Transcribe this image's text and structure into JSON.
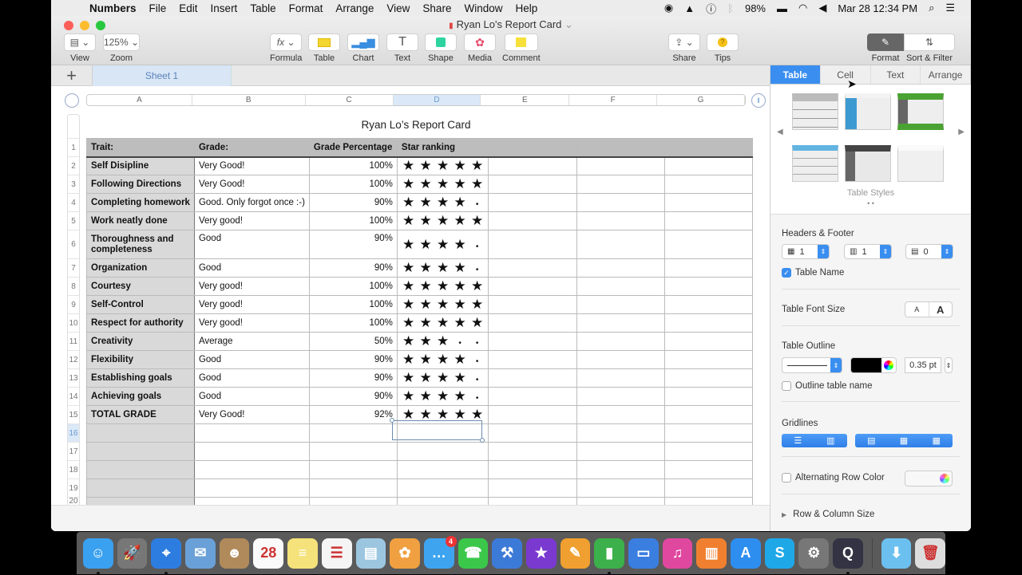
{
  "menubar": {
    "app_name": "Numbers",
    "items": [
      "File",
      "Edit",
      "Insert",
      "Table",
      "Format",
      "Arrange",
      "View",
      "Share",
      "Window",
      "Help"
    ],
    "status": {
      "battery": "98%",
      "datetime": "Mar 28  12:34 PM"
    }
  },
  "window": {
    "title": "Ryan Lo's Report Card",
    "toolbar": {
      "view": "View",
      "zoom_label": "Zoom",
      "zoom_value": "125%",
      "formula": "Formula",
      "table": "Table",
      "chart": "Chart",
      "text": "Text",
      "shape": "Shape",
      "media": "Media",
      "comment": "Comment",
      "share": "Share",
      "tips": "Tips",
      "format": "Format",
      "sort_filter": "Sort & Filter"
    },
    "sheet_tab": "Sheet 1"
  },
  "spreadsheet": {
    "columns": [
      "A",
      "B",
      "C",
      "D",
      "E",
      "F",
      "G"
    ],
    "selected_column": "D",
    "selected_row": 16,
    "row_numbers": [
      "1",
      "2",
      "3",
      "4",
      "5",
      "6",
      "7",
      "8",
      "9",
      "10",
      "11",
      "12",
      "13",
      "14",
      "15",
      "16",
      "17",
      "18",
      "19",
      "20"
    ],
    "table_name": "Ryan Lo’s Report Card",
    "headers": [
      "Trait:",
      "Grade:",
      "Grade Percentage",
      "Star ranking"
    ],
    "rows": [
      {
        "trait": "Self Disipline",
        "grade": "Very Good!",
        "pct": "100%",
        "stars": 5
      },
      {
        "trait": "Following Directions",
        "grade": "Very Good!",
        "pct": "100%",
        "stars": 5
      },
      {
        "trait": "Completing homework",
        "grade": "Good. Only forgot once :-)",
        "pct": "90%",
        "stars": 4
      },
      {
        "trait": "Work neatly done",
        "grade": "Very good!",
        "pct": "100%",
        "stars": 5
      },
      {
        "trait": "Thoroughness and completeness",
        "grade": "Good",
        "pct": "90%",
        "stars": 4
      },
      {
        "trait": "Organization",
        "grade": "Good",
        "pct": "90%",
        "stars": 4
      },
      {
        "trait": "Courtesy",
        "grade": "Very good!",
        "pct": "100%",
        "stars": 5
      },
      {
        "trait": "Self-Control",
        "grade": "Very good!",
        "pct": "100%",
        "stars": 5
      },
      {
        "trait": "Respect for authority",
        "grade": "Very good!",
        "pct": "100%",
        "stars": 5
      },
      {
        "trait": "Creativity",
        "grade": "Average",
        "pct": "50%",
        "stars": 3
      },
      {
        "trait": "Flexibility",
        "grade": "Good",
        "pct": "90%",
        "stars": 4
      },
      {
        "trait": "Establishing goals",
        "grade": "Good",
        "pct": "90%",
        "stars": 4
      },
      {
        "trait": "Achieving goals",
        "grade": "Good",
        "pct": "90%",
        "stars": 4
      },
      {
        "trait": "TOTAL GRADE",
        "grade": "Very Good!",
        "pct": "92%",
        "stars": 5
      }
    ],
    "star_glyph": "★",
    "empty_glyph": "•"
  },
  "inspector": {
    "tabs": [
      "Table",
      "Cell",
      "Text",
      "Arrange"
    ],
    "active_tab": "Table",
    "table_styles_label": "Table Styles",
    "headers_footer_label": "Headers & Footer",
    "header_rows": "1",
    "header_columns": "1",
    "footer_rows": "0",
    "table_name_label": "Table Name",
    "table_name_checked": true,
    "font_size_label": "Table Font Size",
    "font_small": "A",
    "font_large": "A",
    "outline_label": "Table Outline",
    "outline_width": "0.35 pt",
    "outline_color": "#000000",
    "outline_name_label": "Outline table name",
    "outline_name_checked": false,
    "gridlines_label": "Gridlines",
    "alt_row_label": "Alternating Row Color",
    "alt_row_checked": false,
    "row_col_size_label": "Row & Column Size"
  },
  "dock": {
    "apps": [
      {
        "name": "Finder",
        "color": "#3aa0f0",
        "glyph": "☺",
        "running": true
      },
      {
        "name": "Launchpad",
        "color": "#777",
        "glyph": "🚀",
        "running": false
      },
      {
        "name": "Safari",
        "color": "#2d7de0",
        "glyph": "⌖",
        "running": true
      },
      {
        "name": "Mail",
        "color": "#6aa0d8",
        "glyph": "✉",
        "running": false
      },
      {
        "name": "Contacts",
        "color": "#b08a5a",
        "glyph": "☻",
        "running": false
      },
      {
        "name": "Calendar",
        "color": "#fafafa",
        "glyph": "28",
        "running": false
      },
      {
        "name": "Notes",
        "color": "#f5e27a",
        "glyph": "≡",
        "running": false
      },
      {
        "name": "Reminders",
        "color": "#f5f5f5",
        "glyph": "☰",
        "running": false
      },
      {
        "name": "Preview",
        "color": "#9cc6e0",
        "glyph": "▤",
        "running": false
      },
      {
        "name": "Photos",
        "color": "#f0a040",
        "glyph": "✿",
        "running": false
      },
      {
        "name": "Messages",
        "color": "#3ea4f0",
        "glyph": "…",
        "running": false,
        "badge": "4"
      },
      {
        "name": "FaceTime",
        "color": "#3bc84a",
        "glyph": "☎",
        "running": false
      },
      {
        "name": "Xcode",
        "color": "#3c7ad8",
        "glyph": "⚒",
        "running": false
      },
      {
        "name": "iMovie",
        "color": "#7a3ad0",
        "glyph": "★",
        "running": false
      },
      {
        "name": "Pages",
        "color": "#f0a030",
        "glyph": "✎",
        "running": false
      },
      {
        "name": "Numbers",
        "color": "#3cb04a",
        "glyph": "▮",
        "running": true
      },
      {
        "name": "Keynote",
        "color": "#3a7ee0",
        "glyph": "▭",
        "running": false
      },
      {
        "name": "iTunes",
        "color": "#e048a0",
        "glyph": "♫",
        "running": false
      },
      {
        "name": "iBooks",
        "color": "#f08030",
        "glyph": "▥",
        "running": false
      },
      {
        "name": "App Store",
        "color": "#2e8ef0",
        "glyph": "A",
        "running": false
      },
      {
        "name": "Skype",
        "color": "#1ea8e8",
        "glyph": "S",
        "running": false
      },
      {
        "name": "System Preferences",
        "color": "#777",
        "glyph": "⚙",
        "running": false
      },
      {
        "name": "QuickTime Player",
        "color": "#334",
        "glyph": "Q",
        "running": true
      },
      {
        "name": "Downloads",
        "color": "#6cc0f0",
        "glyph": "⬇",
        "running": false
      },
      {
        "name": "Trash",
        "color": "#ddd",
        "glyph": "🗑",
        "running": false
      }
    ]
  }
}
